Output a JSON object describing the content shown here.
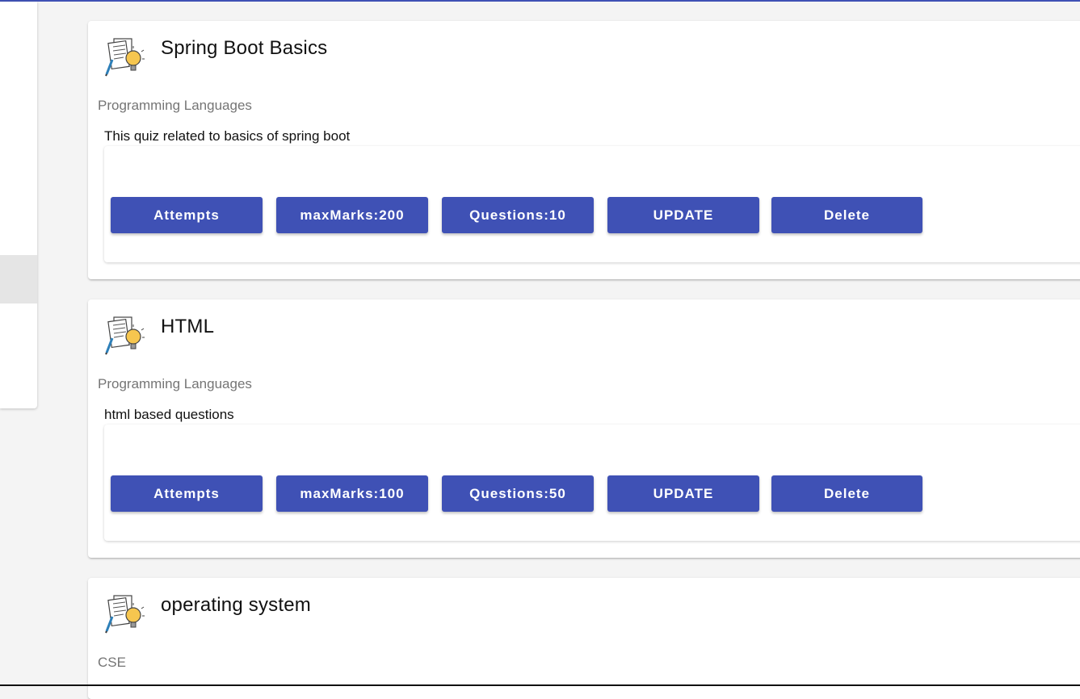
{
  "quizzes": [
    {
      "title": "Spring Boot Basics",
      "category": "Programming Languages",
      "description": "This quiz related to basics of spring boot",
      "attempts_label": "Attempts",
      "max_marks_label": "maxMarks:200",
      "questions_label": "Questions:10",
      "update_label": "UPDATE",
      "delete_label": "Delete"
    },
    {
      "title": "HTML",
      "category": "Programming Languages",
      "description": "html based questions",
      "attempts_label": "Attempts",
      "max_marks_label": "maxMarks:100",
      "questions_label": "Questions:50",
      "update_label": "UPDATE",
      "delete_label": "Delete"
    },
    {
      "title": "operating system",
      "category": "CSE"
    }
  ],
  "theme": {
    "primary": "#3f51b5",
    "background": "#f4f4f4",
    "card": "#ffffff"
  },
  "icons": {
    "quiz": "quiz-notes-lightbulb-icon"
  }
}
